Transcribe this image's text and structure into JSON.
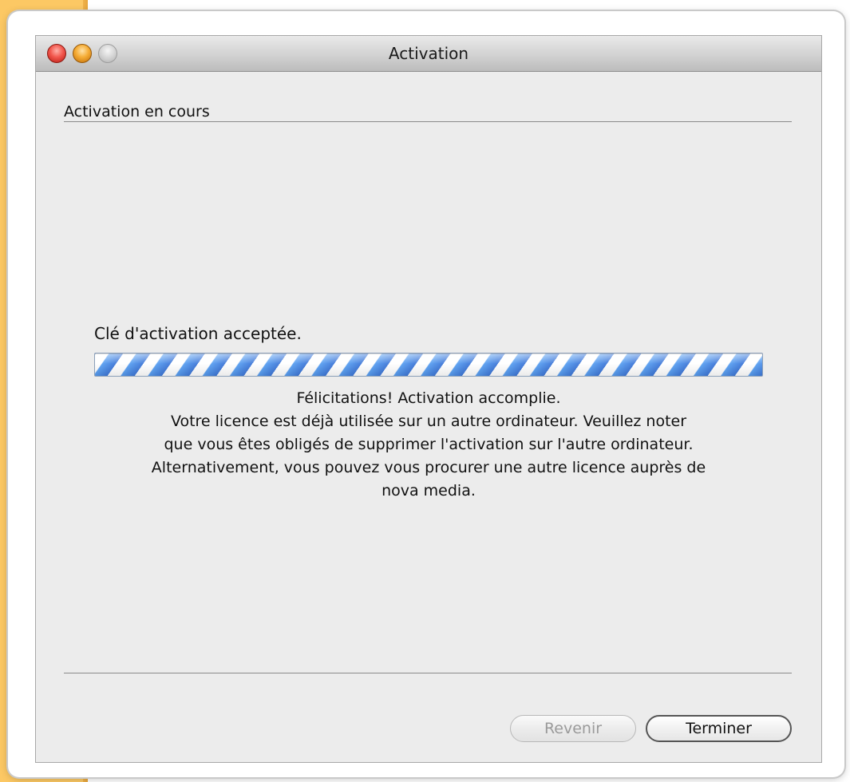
{
  "window": {
    "title": "Activation"
  },
  "section": {
    "heading": "Activation en cours"
  },
  "status": {
    "label": "Clé d'activation acceptée.",
    "progress_style": "indeterminate-barber-pole"
  },
  "message": {
    "lines": [
      "Félicitations! Activation accomplie.",
      "Votre licence est déjà utilisée sur un autre ordinateur. Veuillez noter",
      "que vous êtes obligés de supprimer l'activation sur l'autre ordinateur.",
      "Alternativement, vous pouvez vous procurer une autre licence auprès de",
      "nova media."
    ]
  },
  "buttons": {
    "back_label": "Revenir",
    "finish_label": "Terminer"
  },
  "colors": {
    "background_accent": "#fcc864",
    "window_background": "#ececec",
    "progress_blue": "#3f78d8",
    "close_button": "#f2574d",
    "minimize_button": "#f5ac35"
  }
}
